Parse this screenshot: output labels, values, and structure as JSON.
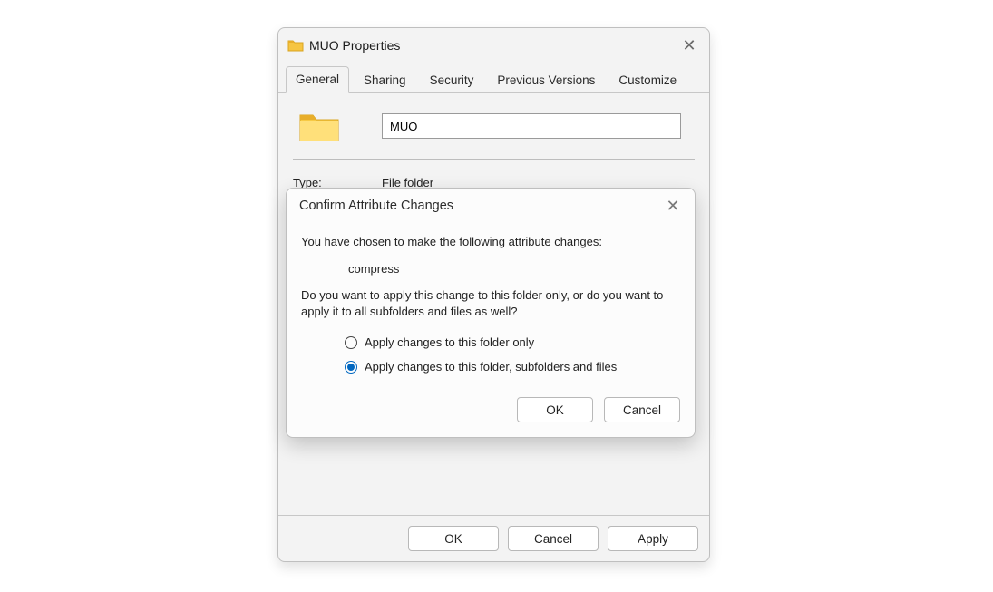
{
  "properties_dialog": {
    "title": "MUO Properties",
    "tabs": {
      "general": "General",
      "sharing": "Sharing",
      "security": "Security",
      "previous_versions": "Previous Versions",
      "customize": "Customize"
    },
    "folder_name": "MUO",
    "type_label": "Type:",
    "type_value": "File folder",
    "buttons": {
      "ok": "OK",
      "cancel": "Cancel",
      "apply": "Apply"
    }
  },
  "confirm_dialog": {
    "title": "Confirm Attribute Changes",
    "intro": "You have chosen to make the following attribute changes:",
    "change": "compress",
    "question": "Do you want to apply this change to this folder only, or do you want to apply it to all subfolders and files as well?",
    "option_folder_only": "Apply changes to this folder only",
    "option_recursive": "Apply changes to this folder, subfolders and files",
    "buttons": {
      "ok": "OK",
      "cancel": "Cancel"
    }
  }
}
